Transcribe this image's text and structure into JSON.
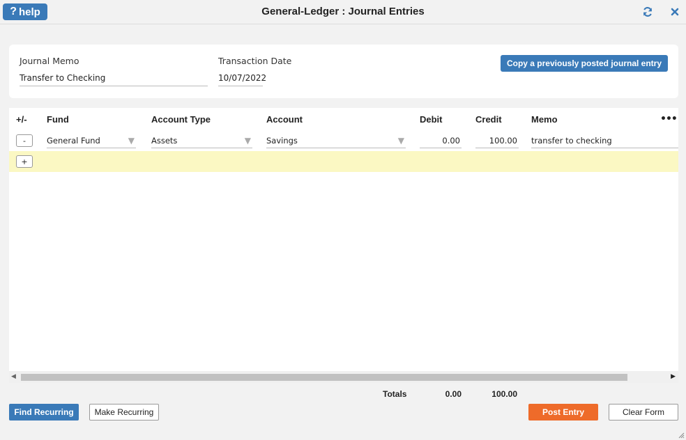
{
  "window": {
    "title": "General-Ledger : Journal Entries",
    "help_label": "help"
  },
  "header": {
    "memo_label": "Journal Memo",
    "memo_value": "Transfer to Checking",
    "date_label": "Transaction Date",
    "date_value": "10/07/2022",
    "copy_button": "Copy a previously posted journal entry"
  },
  "grid": {
    "columns": {
      "plusminus": "+/-",
      "fund": "Fund",
      "account_type": "Account Type",
      "account": "Account",
      "debit": "Debit",
      "credit": "Credit",
      "memo": "Memo"
    },
    "more_icon": "•••",
    "rows": [
      {
        "remove_label": "-",
        "fund": "General Fund",
        "account_type": "Assets",
        "account": "Savings",
        "debit": "0.00",
        "credit": "100.00",
        "memo": "transfer to checking"
      }
    ],
    "add_label": "+"
  },
  "totals": {
    "label": "Totals",
    "debit": "0.00",
    "credit": "100.00"
  },
  "buttons": {
    "find_recurring": "Find Recurring",
    "make_recurring": "Make Recurring",
    "post_entry": "Post Entry",
    "clear_form": "Clear Form"
  },
  "colors": {
    "primary_blue": "#3a7ab8",
    "post_orange": "#ee6b2a",
    "add_row_yellow": "#fbf8c3"
  }
}
